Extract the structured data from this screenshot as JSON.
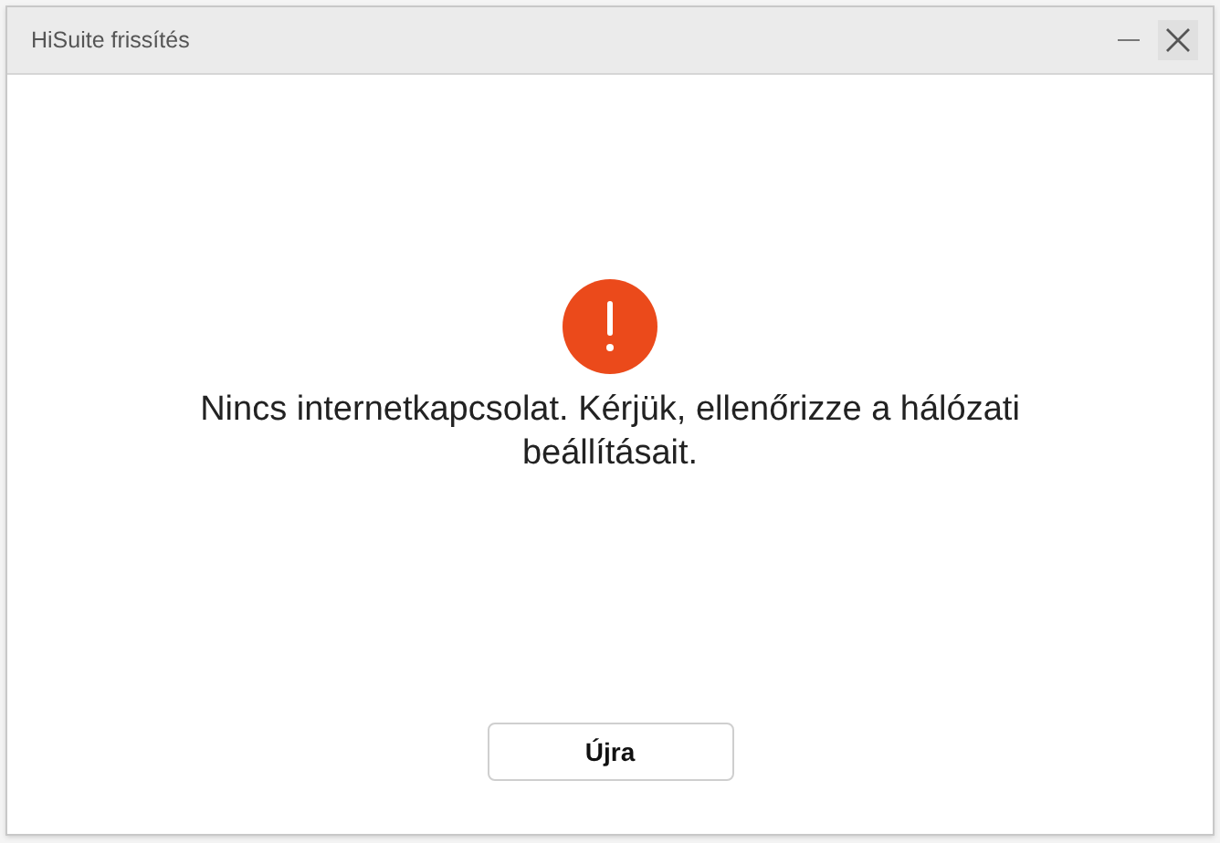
{
  "window": {
    "title": "HiSuite frissítés"
  },
  "message": "Nincs internetkapcsolat. Kérjük, ellenőrizze a hálózati beállításait.",
  "buttons": [
    "Újra"
  ]
}
